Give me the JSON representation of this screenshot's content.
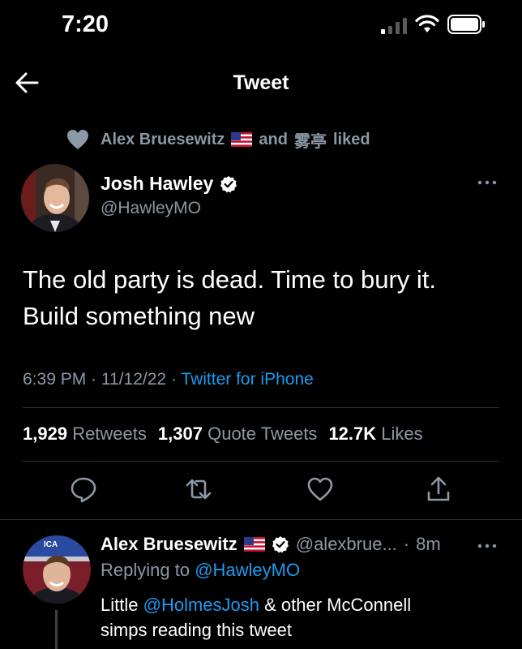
{
  "status_bar": {
    "time": "7:20"
  },
  "nav": {
    "title": "Tweet"
  },
  "social_context": {
    "liker1": "Alex Bruesewitz",
    "connector": "and",
    "liker2": "雾亭",
    "suffix": "liked"
  },
  "tweet": {
    "author_name": "Josh Hawley",
    "author_handle": "@HawleyMO",
    "text_line1": "The old party is dead. Time to bury it.",
    "text_line2": "Build something new",
    "time": "6:39 PM",
    "sep1": "·",
    "date": "11/12/22",
    "sep2": "·",
    "source": "Twitter for iPhone"
  },
  "stats": {
    "retweets_count": "1,929",
    "retweets_label": "Retweets",
    "quotes_count": "1,307",
    "quotes_label": "Quote Tweets",
    "likes_count": "12.7K",
    "likes_label": "Likes"
  },
  "reply": {
    "author_name": "Alex Bruesewitz",
    "author_handle": "@alexbrue...",
    "sep": "·",
    "age": "8m",
    "replying_prefix": "Replying to",
    "replying_to": "@HawleyMO",
    "text_pre": "Little",
    "text_mention": "@HolmesJosh",
    "text_post_line1": "& other McConnell",
    "text_line2": "simps reading this tweet",
    "avatar_banner_text": "ICA"
  },
  "colors": {
    "background": "#000000",
    "primary_text": "#ffffff",
    "secondary_text": "#8b98a5",
    "link": "#1d9bf0",
    "divider": "#2f3336"
  },
  "icons": [
    "back-arrow-icon",
    "heart-icon",
    "verified-badge-icon",
    "more-icon",
    "reply-icon",
    "retweet-icon",
    "like-icon",
    "share-icon",
    "signal-icon",
    "wifi-icon",
    "battery-icon",
    "us-flag-icon"
  ]
}
